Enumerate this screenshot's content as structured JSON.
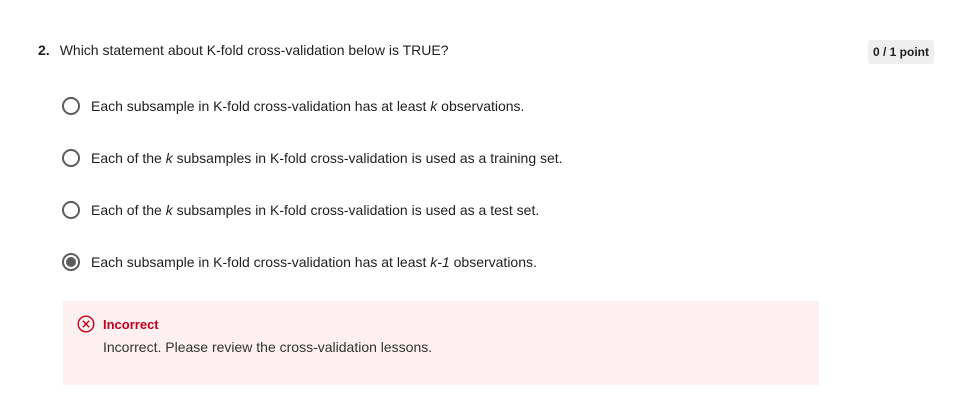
{
  "question": {
    "number": "2.",
    "text": "Which statement about K-fold cross-validation below is TRUE?",
    "points": "0 / 1 point"
  },
  "options": [
    {
      "pre": "Each subsample in K-fold cross-validation has at least ",
      "em": "k",
      "post": " observations.",
      "selected": false
    },
    {
      "pre": "Each of the ",
      "em": "k",
      "post": " subsamples in K-fold cross-validation is used as a training set.",
      "selected": false
    },
    {
      "pre": "Each of the ",
      "em": "k",
      "post": " subsamples in K-fold cross-validation is used as a test set.",
      "selected": false
    },
    {
      "pre": "Each subsample in K-fold cross-validation has at least ",
      "em": "k-1",
      "post": " observations.",
      "selected": true
    }
  ],
  "feedback": {
    "status": "Incorrect",
    "message": "Incorrect. Please review the cross-validation lessons.",
    "icon": "close-circle-icon",
    "color": "#c4001a"
  }
}
